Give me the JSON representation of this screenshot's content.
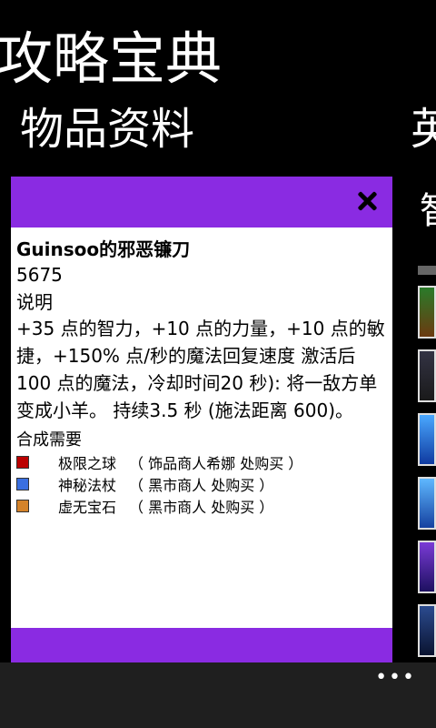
{
  "app_title": "攻略宝典",
  "pivot": {
    "current": "物品资料",
    "next": "英"
  },
  "background_peek": "智",
  "dialog": {
    "close_icon": "close-icon",
    "item_name": "Guinsoo的邪恶镰刀",
    "cost": "5675",
    "description_label": "说明",
    "description_lines": [
      "+35 点的智力，+10 点的力量，+10 点的敏",
      "捷，+150% 点/秒的魔法回复速度 激活后",
      "100 点的魔法，冷却时间20 秒): 将一敌方单",
      "变成小羊。 持续3.5 秒 (施法距离 600)。"
    ],
    "recipe_label": "合成需要",
    "recipe": [
      {
        "icon": "orb-icon",
        "name": "极限之球",
        "where": "（ 饰品商人希娜 处购买 ）"
      },
      {
        "icon": "staff-icon",
        "name": "神秘法杖",
        "where": "（ 黑市商人 处购买 ）"
      },
      {
        "icon": "gem-icon",
        "name": "虚无宝石",
        "where": "（ 黑市商人 处购买 ）"
      }
    ]
  },
  "app_bar": {
    "more_label": "•••"
  },
  "colors": {
    "accent": "#8a2be2",
    "background": "#000000",
    "dialog_bg": "#ffffff",
    "app_bar_bg": "#1f1f1f"
  }
}
